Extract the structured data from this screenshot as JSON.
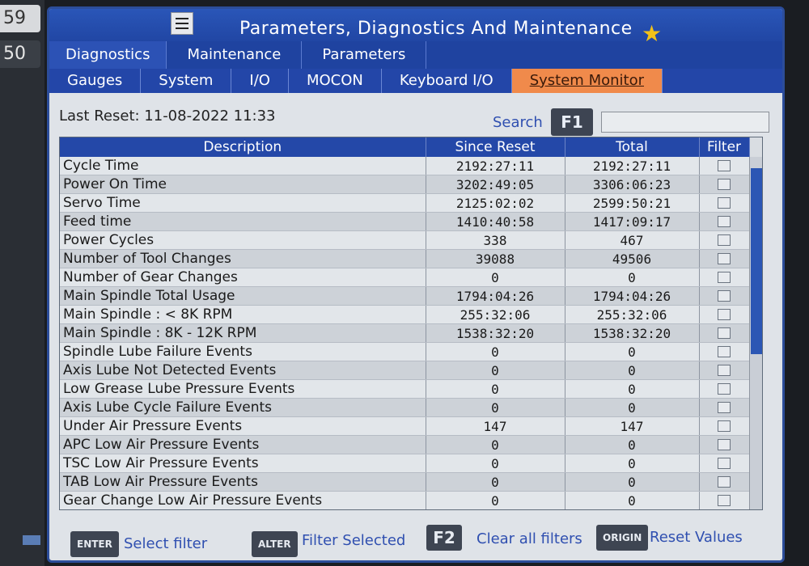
{
  "edge_labels": [
    "59",
    "50"
  ],
  "window": {
    "title": "Parameters, Diagnostics And Maintenance"
  },
  "tabs": [
    {
      "label": "Diagnostics",
      "active": true
    },
    {
      "label": "Maintenance",
      "active": false
    },
    {
      "label": "Parameters",
      "active": false
    }
  ],
  "subtabs": [
    {
      "label": "Gauges",
      "active": false
    },
    {
      "label": "System",
      "active": false
    },
    {
      "label": "I/O",
      "active": false
    },
    {
      "label": "MOCON",
      "active": false
    },
    {
      "label": "Keyboard I/O",
      "active": false
    },
    {
      "label": "System Monitor",
      "active": true
    }
  ],
  "info": {
    "last_reset": "Last Reset: 11-08-2022 11:33",
    "search_label": "Search",
    "search_key": "F1",
    "search_value": ""
  },
  "table": {
    "headers": {
      "description": "Description",
      "since_reset": "Since Reset",
      "total": "Total",
      "filter": "Filter"
    },
    "rows": [
      {
        "description": "Cycle Time",
        "since_reset": "2192:27:11",
        "total": "2192:27:11"
      },
      {
        "description": "Power On Time",
        "since_reset": "3202:49:05",
        "total": "3306:06:23"
      },
      {
        "description": "Servo Time",
        "since_reset": "2125:02:02",
        "total": "2599:50:21"
      },
      {
        "description": "Feed time",
        "since_reset": "1410:40:58",
        "total": "1417:09:17"
      },
      {
        "description": "Power Cycles",
        "since_reset": "338",
        "total": "467"
      },
      {
        "description": "Number of Tool Changes",
        "since_reset": "39088",
        "total": "49506"
      },
      {
        "description": "Number of Gear Changes",
        "since_reset": "0",
        "total": "0"
      },
      {
        "description": "Main Spindle Total Usage",
        "since_reset": "1794:04:26",
        "total": "1794:04:26"
      },
      {
        "description": "Main Spindle : < 8K RPM",
        "since_reset": "255:32:06",
        "total": "255:32:06"
      },
      {
        "description": "Main Spindle : 8K - 12K RPM",
        "since_reset": "1538:32:20",
        "total": "1538:32:20"
      },
      {
        "description": "Spindle Lube Failure Events",
        "since_reset": "0",
        "total": "0"
      },
      {
        "description": "Axis Lube Not Detected Events",
        "since_reset": "0",
        "total": "0"
      },
      {
        "description": "Low Grease Lube Pressure Events",
        "since_reset": "0",
        "total": "0"
      },
      {
        "description": "Axis Lube Cycle Failure Events",
        "since_reset": "0",
        "total": "0"
      },
      {
        "description": "Under Air Pressure Events",
        "since_reset": "147",
        "total": "147"
      },
      {
        "description": "APC Low Air Pressure Events",
        "since_reset": "0",
        "total": "0"
      },
      {
        "description": "TSC Low Air Pressure Events",
        "since_reset": "0",
        "total": "0"
      },
      {
        "description": "TAB Low Air Pressure Events",
        "since_reset": "0",
        "total": "0"
      },
      {
        "description": "Gear Change Low Air Pressure Events",
        "since_reset": "0",
        "total": "0"
      }
    ]
  },
  "footer": {
    "enter_key": "ENTER",
    "enter_action": "Select filter",
    "alter_key": "ALTER",
    "alter_action": "Filter Selected",
    "f2_key": "F2",
    "f2_action": "Clear all filters",
    "origin_key": "ORIGIN",
    "origin_action": "Reset Values"
  },
  "colors": {
    "title_bar": "#1f43a0",
    "active_subtab": "#f08a4b",
    "accent_text": "#2f4fb0",
    "star": "#f2c118"
  },
  "icons": [
    "hamburger-menu-icon",
    "star-icon"
  ]
}
